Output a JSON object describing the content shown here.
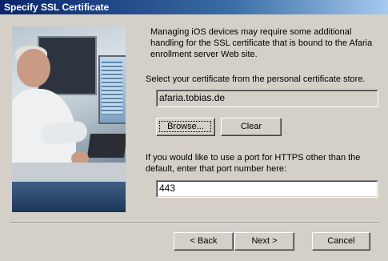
{
  "window": {
    "title": "Specify SSL Certificate"
  },
  "intro_text": "Managing iOS devices may require some additional handling for the SSL certificate that is bound to the Afaria enrollment server Web site.",
  "certificate": {
    "label": "Select your certificate from the personal certificate store.",
    "value": "afaria.tobias.de",
    "browse_label": "Browse...",
    "clear_label": "Clear"
  },
  "port": {
    "label": "If you would like to use a port for HTTPS other than the default, enter that port number here:",
    "value": "443"
  },
  "navigation": {
    "back_label": "< Back",
    "next_label": "Next >",
    "cancel_label": "Cancel"
  },
  "colors": {
    "dialog_bg": "#d4d0c8",
    "titlebar_start": "#0a246a",
    "titlebar_end": "#a6caf0"
  }
}
